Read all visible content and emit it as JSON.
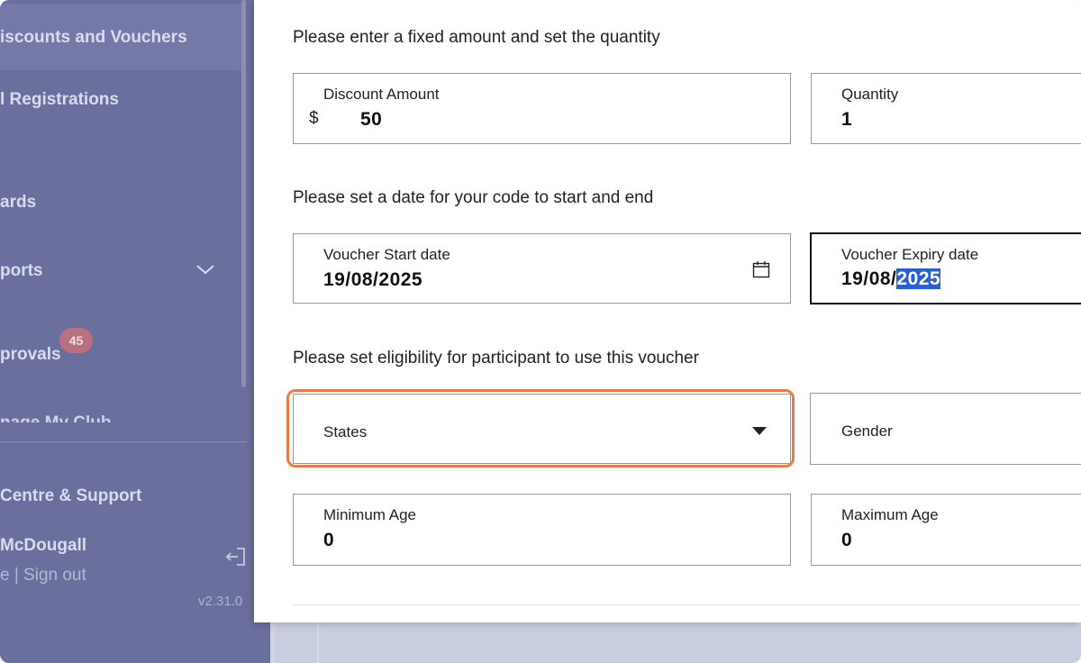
{
  "sidebar": {
    "items": [
      {
        "label": "iscounts and Vouchers"
      },
      {
        "label": "l Registrations"
      },
      {
        "label": "ards"
      },
      {
        "label": "ports"
      },
      {
        "label": "provals"
      },
      {
        "label": "nage My Club"
      }
    ],
    "approvals_badge": "45",
    "help_label": "Centre & Support",
    "user_name": "McDougall",
    "profile_signout": "e | Sign out",
    "version": "v2.31.0"
  },
  "form": {
    "amount_section_title": "Please enter a fixed amount and set the quantity",
    "discount_amount": {
      "label": "Discount Amount",
      "currency": "$",
      "value": "50"
    },
    "quantity": {
      "label": "Quantity",
      "value": "1"
    },
    "date_section_title": "Please set a date for your code to start and end",
    "start_date": {
      "label": "Voucher Start date",
      "value": "19/08/2025"
    },
    "expiry_date": {
      "label": "Voucher Expiry date",
      "value_prefix": "19/08/",
      "value_selected": "2025"
    },
    "eligibility_section_title": "Please set eligibility for participant to use this voucher",
    "states": {
      "placeholder": "States"
    },
    "gender": {
      "placeholder": "Gender"
    },
    "min_age": {
      "label": "Minimum Age",
      "value": "0"
    },
    "max_age": {
      "label": "Maximum Age",
      "value": "0"
    }
  },
  "colors": {
    "sidebar_bg": "#6a6f9e",
    "highlight": "#ef7a45",
    "text_selection": "#2b5fd1"
  }
}
